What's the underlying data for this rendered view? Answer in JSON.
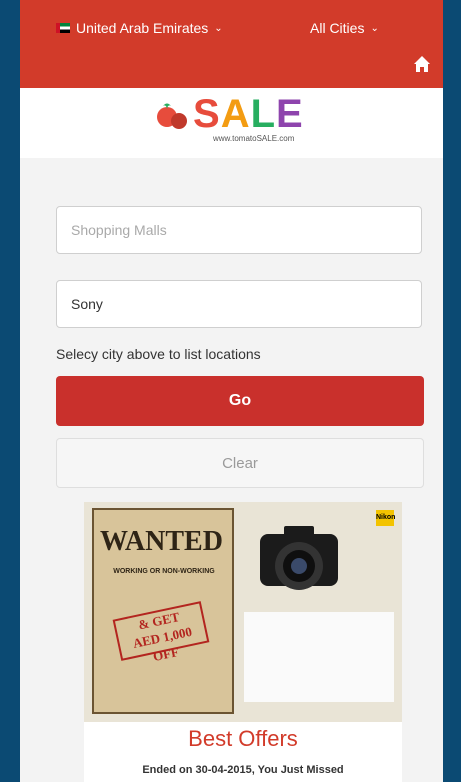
{
  "header": {
    "country": "United Arab Emirates",
    "cities": "All Cities",
    "brand_color": "#d23b2a"
  },
  "logo": {
    "wordmark": "SALE",
    "tagline": "www.tomatoSALE.com"
  },
  "form": {
    "mall_placeholder": "Shopping Malls",
    "brand_value": "Sony",
    "hint": "Selecy city above to list locations",
    "go_label": "Go",
    "clear_label": "Clear"
  },
  "offer": {
    "poster_title": "WANTED",
    "poster_subtitle": "WORKING OR NON-WORKING",
    "stamp_line1": "& GET",
    "stamp_line2": "AED 1,000 OFF",
    "brand_badge": "Nikon",
    "section_title": "Best Offers",
    "status": "Ended on 30-04-2015, You Just Missed"
  }
}
